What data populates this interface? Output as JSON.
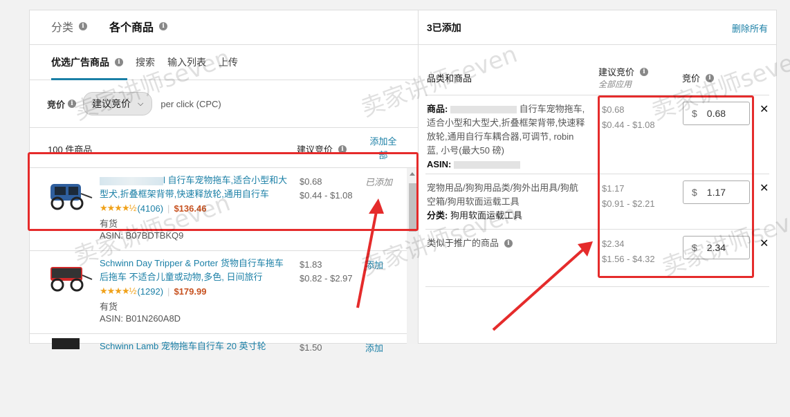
{
  "left": {
    "tabs": [
      {
        "label": "分类"
      },
      {
        "label": "各个商品"
      }
    ],
    "subtabs": [
      {
        "label": "优选广告商品"
      },
      {
        "label": "搜索"
      },
      {
        "label": "输入列表"
      },
      {
        "label": "上传"
      }
    ],
    "bid": {
      "label": "竞价",
      "select_value": "建议竞价",
      "suffix": "per click (CPC)"
    },
    "list_header": {
      "count": "100 件商品",
      "suggested_bid": "建议竞价",
      "add_all": "添加全部"
    },
    "products": [
      {
        "title": "l 自行车宠物拖车,适合小型和大型犬,折叠框架背带,快速释放轮,通用自行车",
        "stars": "★★★★½",
        "reviews": "(4106)",
        "price": "$136.46",
        "stock": "有货",
        "asin": "ASIN: B07BDTBKQ9",
        "bid": "$0.68",
        "bid_range": "$0.44 - $1.08",
        "action": "已添加"
      },
      {
        "title": "Schwinn Day Tripper & Porter 货物自行车拖车 后拖车 不适合儿童或动物,多色, 日间旅行",
        "stars": "★★★★½",
        "reviews": "(1292)",
        "price": "$179.99",
        "stock": "有货",
        "asin": "ASIN: B01N260A8D",
        "bid": "$1.83",
        "bid_range": "$0.82 - $2.97",
        "action": "添加"
      },
      {
        "title": "Schwinn Lamb 宠物拖车自行车 20 英寸轮",
        "bid": "$1.50",
        "action": "添加"
      }
    ]
  },
  "right": {
    "title": "3已添加",
    "delete_all": "删除所有",
    "col_category": "品类和商品",
    "col_suggested": "建议竞价",
    "col_suggested_sub": "全部应用",
    "col_bid": "竞价",
    "rows": [
      {
        "label": "商品:",
        "text": "自行车宠物拖车,适合小型和大型犬,折叠框架背带,快速释放轮,通用自行车耦合器,可调节, robin 蓝, 小号(最大50 磅)",
        "asin_label": "ASIN:",
        "bid": "$0.68",
        "range": "$0.44 - $1.08",
        "currency": "$",
        "value": "0.68"
      },
      {
        "text": "宠物用品/狗狗用品类/狗外出用具/狗航空箱/狗用软面运载工具",
        "sub_label": "分类:",
        "sub_text": "狗用软面运载工具",
        "bid": "$1.17",
        "range": "$0.91 - $2.21",
        "currency": "$",
        "value": "1.17"
      },
      {
        "text": "类似于推广的商品",
        "bid": "$2.34",
        "range": "$1.56 - $4.32",
        "currency": "$",
        "value": "2.34"
      }
    ]
  },
  "watermark": "卖家讲师seven",
  "colors": {
    "link": "#1a7fa6",
    "price": "#c7511f",
    "star": "#f0a21b",
    "annotation": "#e52b2b"
  }
}
